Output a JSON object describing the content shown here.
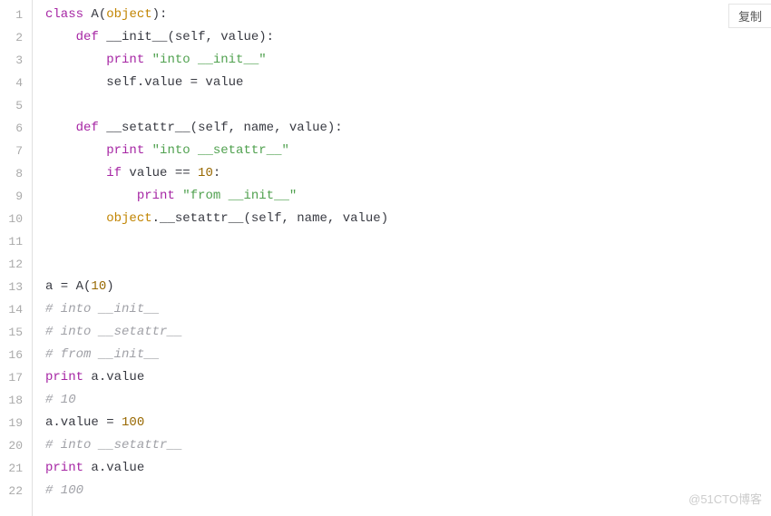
{
  "copy_button_label": "复制",
  "watermark": "@51CTO博客",
  "code_lines": [
    [
      [
        "kw",
        "class"
      ],
      [
        "ident",
        " A"
      ],
      [
        "punct",
        "("
      ],
      [
        "builtin",
        "object"
      ],
      [
        "punct",
        "):"
      ]
    ],
    [
      [
        "ident",
        "    "
      ],
      [
        "kw",
        "def"
      ],
      [
        "ident",
        " __init__"
      ],
      [
        "punct",
        "("
      ],
      [
        "ident",
        "self, value"
      ],
      [
        "punct",
        "):"
      ]
    ],
    [
      [
        "ident",
        "        "
      ],
      [
        "kw",
        "print"
      ],
      [
        "ident",
        " "
      ],
      [
        "str",
        "\"into __init__\""
      ]
    ],
    [
      [
        "ident",
        "        self.value = value"
      ]
    ],
    [
      [
        "ident",
        ""
      ]
    ],
    [
      [
        "ident",
        "    "
      ],
      [
        "kw",
        "def"
      ],
      [
        "ident",
        " __setattr__"
      ],
      [
        "punct",
        "("
      ],
      [
        "ident",
        "self, name, value"
      ],
      [
        "punct",
        "):"
      ]
    ],
    [
      [
        "ident",
        "        "
      ],
      [
        "kw",
        "print"
      ],
      [
        "ident",
        " "
      ],
      [
        "str",
        "\"into __setattr__\""
      ]
    ],
    [
      [
        "ident",
        "        "
      ],
      [
        "kw",
        "if"
      ],
      [
        "ident",
        " value == "
      ],
      [
        "num",
        "10"
      ],
      [
        "punct",
        ":"
      ]
    ],
    [
      [
        "ident",
        "            "
      ],
      [
        "kw",
        "print"
      ],
      [
        "ident",
        " "
      ],
      [
        "str",
        "\"from __init__\""
      ]
    ],
    [
      [
        "ident",
        "        "
      ],
      [
        "builtin",
        "object"
      ],
      [
        "ident",
        ".__setattr__"
      ],
      [
        "punct",
        "("
      ],
      [
        "ident",
        "self, name, value"
      ],
      [
        "punct",
        ")"
      ]
    ],
    [
      [
        "ident",
        ""
      ]
    ],
    [
      [
        "ident",
        ""
      ]
    ],
    [
      [
        "ident",
        "a = A("
      ],
      [
        "num",
        "10"
      ],
      [
        "punct",
        ")"
      ]
    ],
    [
      [
        "cmt",
        "# into __init__"
      ]
    ],
    [
      [
        "cmt",
        "# into __setattr__"
      ]
    ],
    [
      [
        "cmt",
        "# from __init__"
      ]
    ],
    [
      [
        "kw",
        "print"
      ],
      [
        "ident",
        " a.value"
      ]
    ],
    [
      [
        "cmt",
        "# 10"
      ]
    ],
    [
      [
        "ident",
        "a.value = "
      ],
      [
        "num",
        "100"
      ]
    ],
    [
      [
        "cmt",
        "# into __setattr__"
      ]
    ],
    [
      [
        "kw",
        "print"
      ],
      [
        "ident",
        " a.value"
      ]
    ],
    [
      [
        "cmt",
        "# 100"
      ]
    ]
  ]
}
